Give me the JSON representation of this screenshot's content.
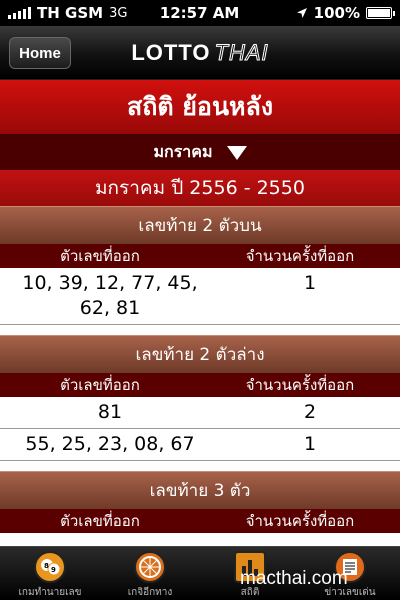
{
  "status": {
    "carrier": "TH GSM",
    "network": "3G",
    "time": "12:57 AM",
    "battery": "100%"
  },
  "nav": {
    "home_label": "Home",
    "logo_main": "LOTTO",
    "logo_thai": "THAI"
  },
  "page": {
    "title": "สถิติ ย้อนหลัง",
    "month": "มกราคม",
    "year_range": "มกราคม ปี 2556 - 2550"
  },
  "col_headers": {
    "number": "ตัวเลขที่ออก",
    "count": "จำนวนครั้งที่ออก"
  },
  "sections": [
    {
      "title": "เลขท้าย 2 ตัวบน",
      "rows": [
        {
          "numbers": "10, 39, 12, 77, 45, 62, 81",
          "count": "1"
        }
      ]
    },
    {
      "title": "เลขท้าย 2 ตัวล่าง",
      "rows": [
        {
          "numbers": "81",
          "count": "2"
        },
        {
          "numbers": "55, 25, 23, 08, 67",
          "count": "1"
        }
      ]
    },
    {
      "title": "เลขท้าย 3 ตัว",
      "rows": []
    }
  ],
  "tabs": [
    {
      "label": "เกมทำนายเลข",
      "icon": "lottery-ball-icon",
      "color": "#e8961e"
    },
    {
      "label": "เกจิอีกทาง",
      "icon": "wheel-icon",
      "color": "#d9701c"
    },
    {
      "label": "สถิติ",
      "icon": "bar-chart-icon",
      "color": "#e08a1a"
    },
    {
      "label": "ข่าวเลขเด่น",
      "icon": "news-icon",
      "color": "#e06a1c"
    }
  ],
  "watermark": "macthai.com"
}
